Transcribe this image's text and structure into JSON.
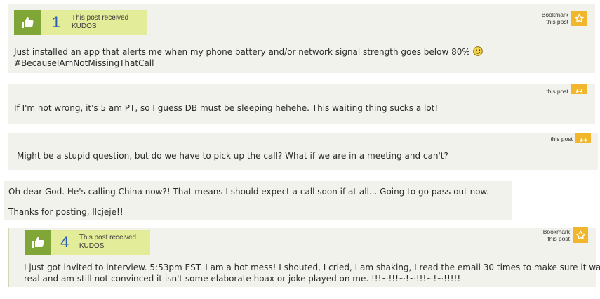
{
  "posts": [
    {
      "kudos": {
        "count": "1",
        "label": "This post received KUDOS"
      },
      "bookmark": {
        "line1": "Bookmark",
        "line2": "this post"
      },
      "lines": [
        "Just installed an app that alerts me when my phone battery and/or network signal strength goes below 80%",
        "#BecauseIAmNotMissingThatCall"
      ]
    },
    {
      "bookmark": {
        "line2": "this post"
      },
      "lines": [
        "If I'm not wrong, it's 5 am PT, so I guess DB must be sleeping hehehe. This waiting thing sucks a lot!"
      ]
    },
    {
      "bookmark": {
        "line2": "this post"
      },
      "lines": [
        "Might be a stupid question, but do we have to pick up the call? What if we are in a meeting and can't?"
      ]
    },
    {
      "lines": [
        "Oh dear God. He's calling China now?! That means I should expect a call soon if at all... Going to go pass out now.",
        "Thanks for posting, llcjeje!!"
      ]
    },
    {
      "kudos": {
        "count": "4",
        "label": "This post received KUDOS"
      },
      "bookmark": {
        "line1": "Bookmark",
        "line2": "this post"
      },
      "lines": [
        "I just got invited to interview. 5:53pm EST. I am a hot mess! I shouted, I cried, I am shaking, I read the email 30 times to make sure it was",
        "real and am still not convinced it isn't some elaborate hoax or joke played on me. !!!~!!!~!~!!!~!~!!!!!"
      ]
    }
  ],
  "colors": {
    "kudos_bg": "#e2ec99",
    "thumb_bg": "#7fa636",
    "star_bg": "#f1b62b",
    "count": "#2a5db6",
    "post_bg": "#f2f2ec"
  },
  "icons": {
    "thumb": "thumbs-up-icon",
    "star": "star-icon",
    "emoji": "smiley-icon"
  }
}
